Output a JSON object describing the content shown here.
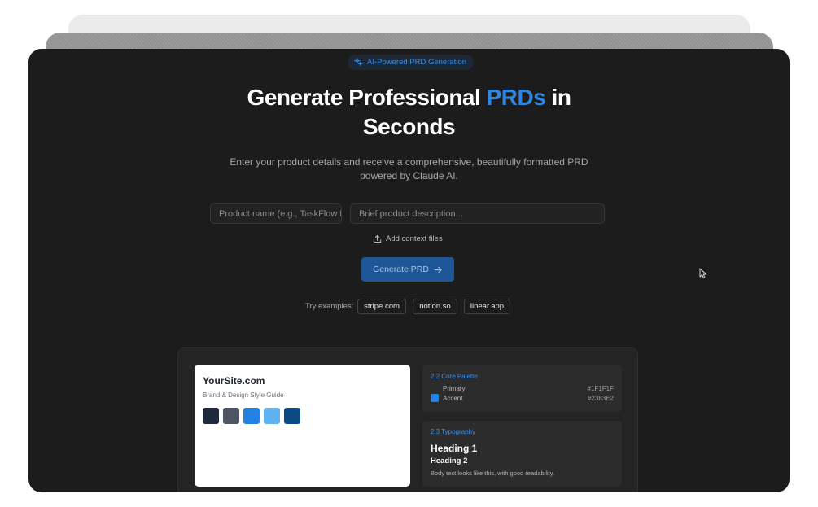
{
  "badge": {
    "label": "AI-Powered PRD Generation",
    "icon": "sparkles-icon"
  },
  "hero": {
    "title_before": "Generate Professional ",
    "title_accent": "PRDs",
    "title_after": " in",
    "title_line2": "Seconds",
    "subtitle_line1": "Enter your product details and receive a comprehensive, beautifully formatted PRD",
    "subtitle_line2": "powered by Claude AI."
  },
  "form": {
    "name_placeholder": "Product name (e.g., TaskFlow P",
    "description_placeholder": "Brief product description...",
    "attach_label": "Add context files",
    "generate_label": "Generate PRD"
  },
  "examples": {
    "label": "Try examples:",
    "items": [
      "stripe.com",
      "notion.so",
      "linear.app"
    ]
  },
  "preview": {
    "site_title": "YourSite.com",
    "site_subtitle": "Brand & Design Style Guide",
    "swatches": [
      "#1e293b",
      "#4b5563",
      "#2383e2",
      "#60b1f0",
      "#0b4a82"
    ],
    "palette_title": "2.2 Core Palette",
    "palette": [
      {
        "name": "Primary",
        "hex": "#1F1F1F"
      },
      {
        "name": "Accent",
        "hex": "#2383E2"
      }
    ],
    "typography_title": "2.3 Typography",
    "heading1": "Heading 1",
    "heading2": "Heading 2",
    "body_sample": "Body text looks like this, with good readability."
  },
  "colors": {
    "accent": "#2f86e0",
    "window_bg": "#1c1c1c",
    "button_bg": "#1f5697"
  }
}
